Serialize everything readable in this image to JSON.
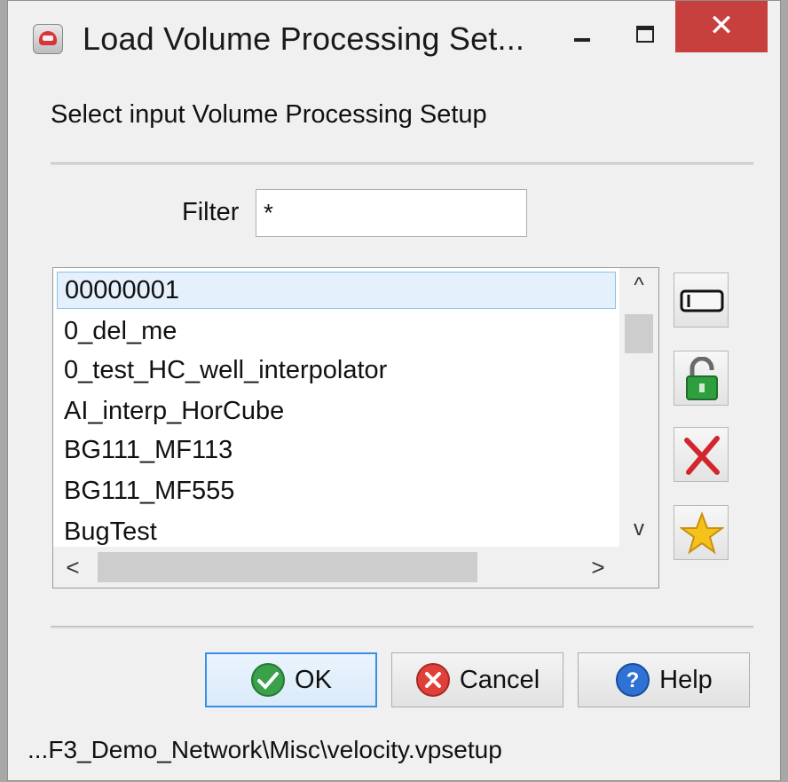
{
  "window": {
    "title": "Load Volume Processing Set...",
    "close_glyph": "✕"
  },
  "instruction": "Select input Volume Processing Setup",
  "filter": {
    "label": "Filter",
    "value": "*"
  },
  "list": {
    "items": [
      "00000001",
      "0_del_me",
      "0_test_HC_well_interpolator",
      "AI_interp_HorCube",
      "BG111_MF113",
      "BG111_MF555",
      "BugTest"
    ],
    "selected_index": 0,
    "scroll_glyphs": {
      "up": "^",
      "down": "v",
      "left": "<",
      "right": ">"
    }
  },
  "side_toolbar": [
    {
      "name": "rename-icon",
      "tooltip": ""
    },
    {
      "name": "unlock-icon",
      "tooltip": ""
    },
    {
      "name": "delete-icon",
      "tooltip": ""
    },
    {
      "name": "star-icon",
      "tooltip": ""
    }
  ],
  "buttons": {
    "ok": "OK",
    "cancel": "Cancel",
    "help": "Help"
  },
  "status": "...F3_Demo_Network\\Misc\\velocity.vpsetup",
  "colors": {
    "close": "#c7403d",
    "selection_bg": "#e4f0fb",
    "selection_border": "#8cc1e9",
    "default_button_border": "#3a8ee6"
  }
}
